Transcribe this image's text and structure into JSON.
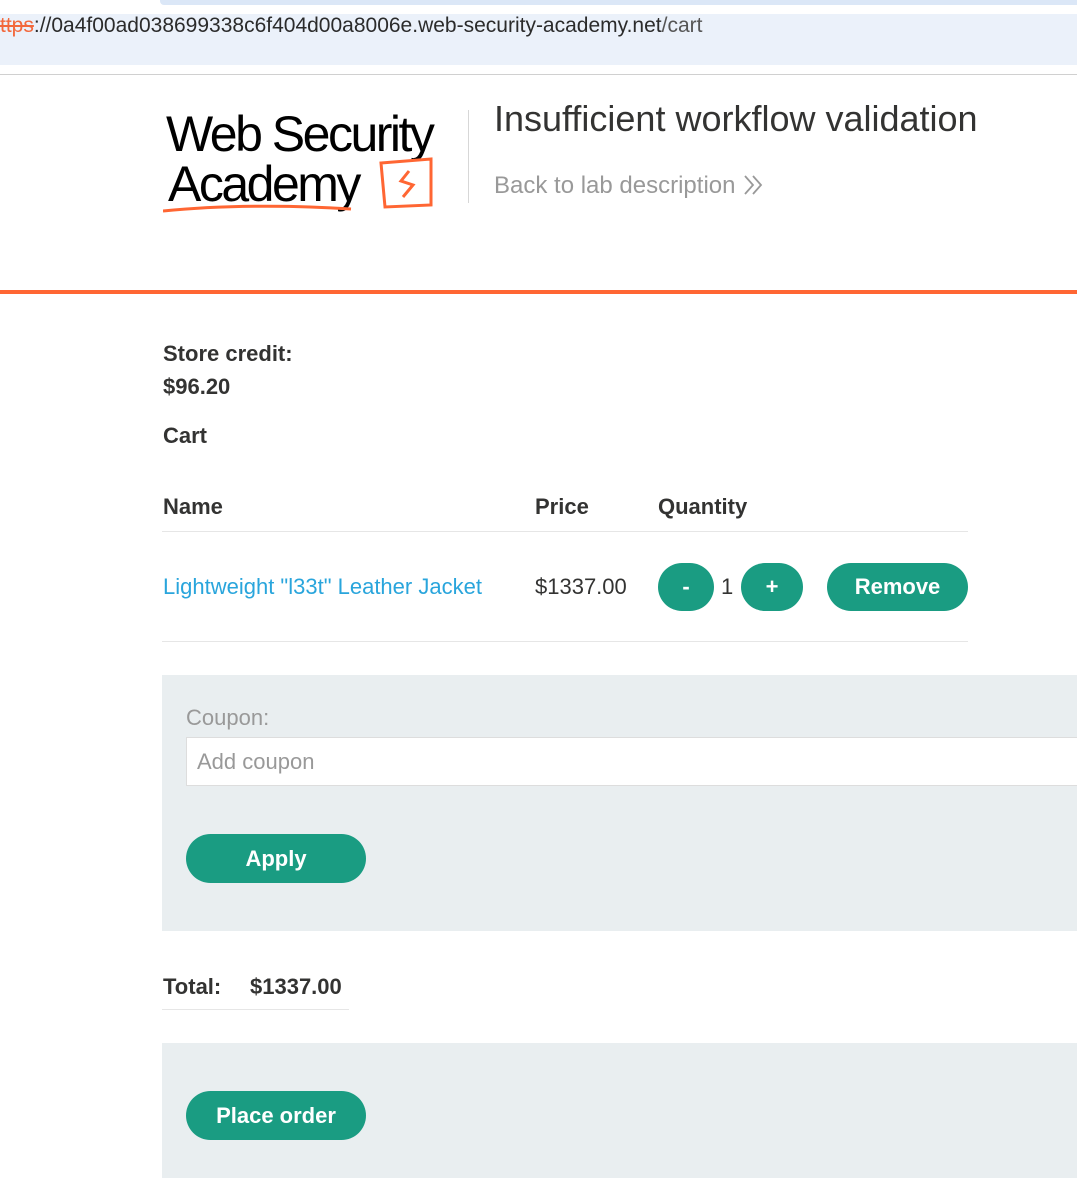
{
  "browser": {
    "url_scheme": "ttps",
    "url_sep": "://",
    "url_host": "0a4f00ad038699338c6f404d00a8006e.web-security-academy.net",
    "url_path": "/cart"
  },
  "header": {
    "logo_line1": "Web Security",
    "logo_line2": "Academy",
    "lab_title": "Insufficient workflow validation",
    "back_link": "Back to lab description",
    "accent_color": "#ff6633"
  },
  "account": {
    "store_credit_label": "Store credit:",
    "store_credit_value": "$96.20"
  },
  "cart": {
    "heading": "Cart",
    "columns": [
      "Name",
      "Price",
      "Quantity"
    ],
    "items": [
      {
        "name": "Lightweight \"l33t\" Leather Jacket",
        "price": "$1337.00",
        "quantity": "1",
        "decrement_label": "-",
        "increment_label": "+",
        "remove_label": "Remove"
      }
    ]
  },
  "coupon": {
    "label": "Coupon:",
    "placeholder": "Add coupon",
    "apply_label": "Apply"
  },
  "total": {
    "label": "Total:",
    "value": "$1337.00"
  },
  "checkout": {
    "place_order_label": "Place order"
  },
  "colors": {
    "button": "#1a9c82",
    "link": "#29a5dc",
    "panel": "#e9eef0"
  }
}
